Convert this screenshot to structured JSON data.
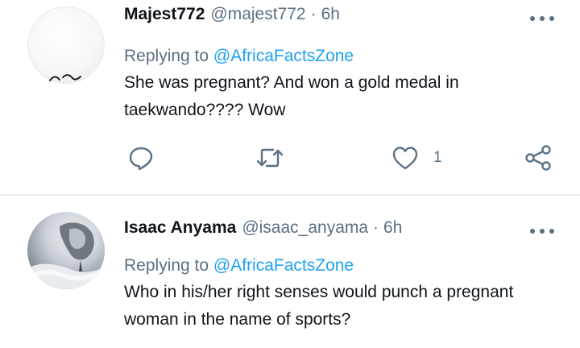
{
  "tweets": [
    {
      "display_name": "Majest772",
      "handle": "@majest772",
      "separator": "·",
      "time": "6h",
      "replying_prefix": "Replying to",
      "replying_to": "@AfricaFactsZone",
      "text": "She was pregnant? And won a gold medal in taekwando???? Wow",
      "like_count": "1",
      "avatar_icon": "blank-avatar",
      "actions": [
        "reply-icon",
        "retweet-icon",
        "like-icon",
        "share-icon"
      ]
    },
    {
      "display_name": "Isaac Anyama",
      "handle": "@isaac_anyama",
      "separator": "·",
      "time": "6h",
      "replying_prefix": "Replying to",
      "replying_to": "@AfricaFactsZone",
      "text": "Who in his/her right senses would punch a pregnant woman in the name of sports?",
      "avatar_icon": "lion-avatar"
    }
  ],
  "colors": {
    "text": "#0f1419",
    "secondary": "#5b7083",
    "accent": "#1da1f2",
    "divider": "#e6ecf0"
  }
}
